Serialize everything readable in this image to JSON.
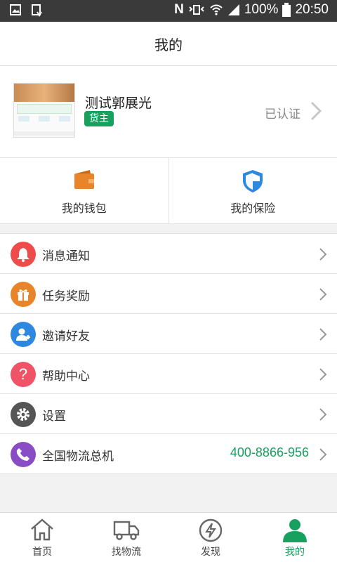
{
  "status_bar": {
    "icons": [
      "image-icon",
      "download-icon",
      "nfc-icon",
      "vibrate-icon",
      "wifi-icon",
      "signal-icon",
      "battery-icon"
    ],
    "battery": "100%",
    "time": "20:50"
  },
  "header": {
    "title": "我的"
  },
  "profile": {
    "name": "测试郭展光",
    "role_badge": "货主",
    "verify_status": "已认证"
  },
  "quick_actions": [
    {
      "label": "我的钱包",
      "icon": "wallet-icon",
      "color": "#e8852a"
    },
    {
      "label": "我的保险",
      "icon": "shield-icon",
      "color": "#2f88e0"
    }
  ],
  "menu": [
    {
      "label": "消息通知",
      "icon": "bell-icon",
      "color": "#ee4b4b"
    },
    {
      "label": "任务奖励",
      "icon": "gift-icon",
      "color": "#e8852a"
    },
    {
      "label": "邀请好友",
      "icon": "add-user-icon",
      "color": "#2f88e0"
    },
    {
      "label": "帮助中心",
      "icon": "question-icon",
      "color": "#ee5368"
    },
    {
      "label": "设置",
      "icon": "gear-icon",
      "color": "#555555"
    },
    {
      "label": "全国物流总机",
      "icon": "phone-icon",
      "color": "#8a4cc4",
      "value": "400-8866-956"
    }
  ],
  "bottom_nav": [
    {
      "label": "首页",
      "icon": "home-icon",
      "active": false
    },
    {
      "label": "找物流",
      "icon": "truck-icon",
      "active": false
    },
    {
      "label": "发现",
      "icon": "discover-icon",
      "active": false
    },
    {
      "label": "我的",
      "icon": "person-icon",
      "active": true
    }
  ],
  "colors": {
    "accent": "#17a05e",
    "status_bar": "#3a3a3a"
  }
}
